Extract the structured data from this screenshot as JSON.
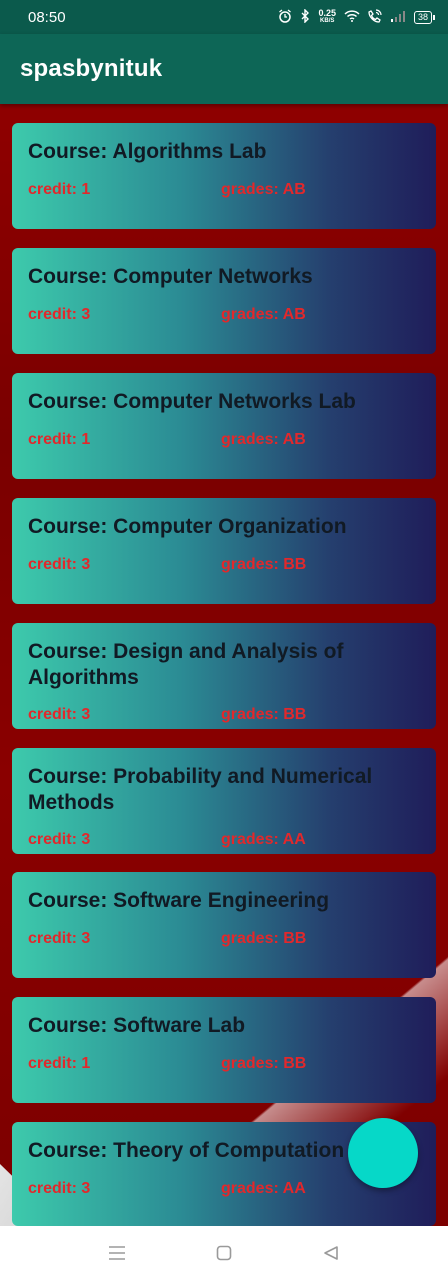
{
  "status_bar": {
    "time": "08:50",
    "net_speed_value": "0.25",
    "net_speed_unit": "KB/S",
    "battery": "38"
  },
  "app_bar": {
    "title": "spasbynituk"
  },
  "courses": [
    {
      "title": "Course: Algorithms Lab",
      "credit": "credit: 1",
      "grades": "grades: AB"
    },
    {
      "title": "Course: Computer Networks",
      "credit": "credit: 3",
      "grades": "grades: AB"
    },
    {
      "title": "Course: Computer Networks Lab",
      "credit": "credit: 1",
      "grades": "grades: AB"
    },
    {
      "title": "Course: Computer Organization",
      "credit": "credit: 3",
      "grades": "grades: BB"
    },
    {
      "title": "Course: Design and Analysis of Algorithms",
      "credit": "credit: 3",
      "grades": "grades: BB"
    },
    {
      "title": "Course: Probability and Numerical Methods",
      "credit": "credit: 3",
      "grades": "grades: AA"
    },
    {
      "title": "Course: Software Engineering",
      "credit": "credit: 3",
      "grades": "grades: BB"
    },
    {
      "title": "Course: Software Lab",
      "credit": "credit: 1",
      "grades": "grades: BB"
    },
    {
      "title": "Course: Theory of Computation",
      "credit": "credit: 3",
      "grades": "grades: AA"
    }
  ],
  "colors": {
    "app_bar": "#0d6656",
    "status_bar": "#0b5a4c",
    "background": "#8f0000",
    "card_start": "#3dcaac",
    "card_end": "#1f1d5a",
    "text_meta": "#e2282b",
    "fab": "#06d8c8"
  }
}
